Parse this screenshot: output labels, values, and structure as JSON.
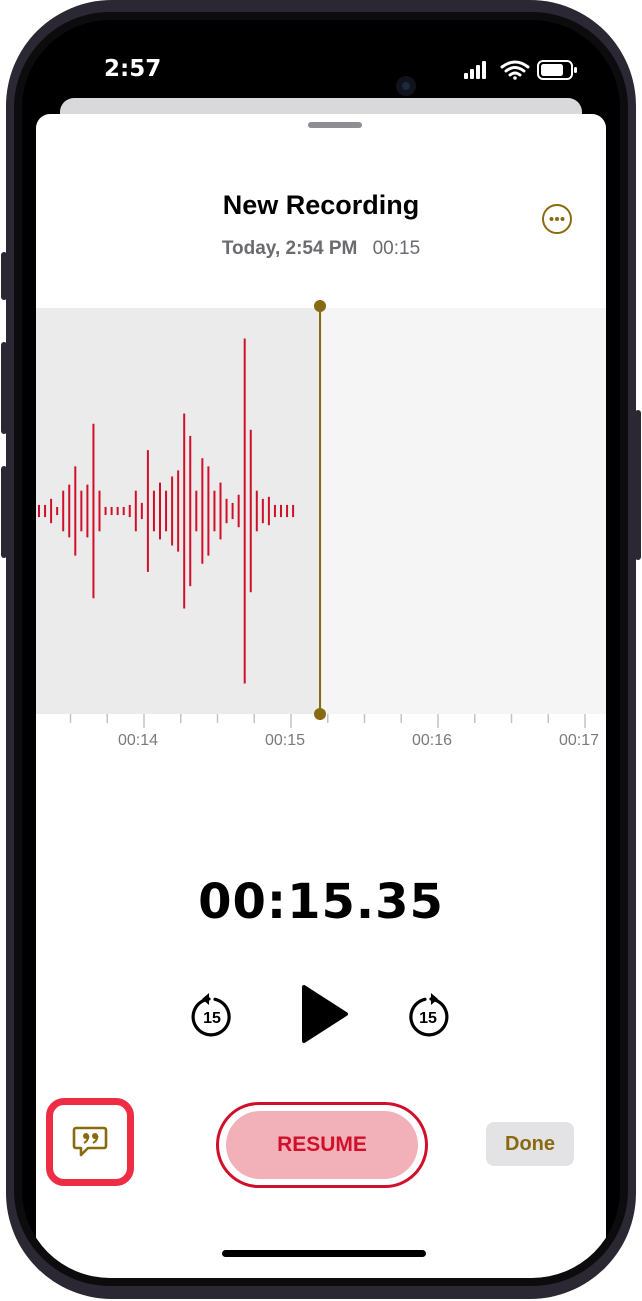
{
  "status_bar": {
    "time": "2:57"
  },
  "recording": {
    "title": "New Recording",
    "date": "Today, 2:54 PM",
    "duration": "00:15"
  },
  "timeline": {
    "ticks": [
      "00:14",
      "00:15",
      "00:16",
      "00:17"
    ]
  },
  "waveform": {
    "amplitudes": [
      0.03,
      0.03,
      0.06,
      0.02,
      0.1,
      0.13,
      0.22,
      0.1,
      0.13,
      0.43,
      0.1,
      0.02,
      0.02,
      0.02,
      0.02,
      0.03,
      0.1,
      0.04,
      0.3,
      0.1,
      0.14,
      0.1,
      0.17,
      0.2,
      0.48,
      0.37,
      0.1,
      0.26,
      0.22,
      0.1,
      0.14,
      0.06,
      0.04,
      0.08,
      0.85,
      0.4,
      0.1,
      0.06,
      0.07,
      0.03,
      0.03,
      0.03,
      0.03
    ],
    "color": "#d0102a"
  },
  "timer": {
    "elapsed": "00:15.35"
  },
  "controls": {
    "skip_back_label": "15",
    "skip_forward_label": "15",
    "resume_label": "RESUME",
    "done_label": "Done"
  },
  "colors": {
    "accent": "#8a6a10",
    "record_red": "#d0102a",
    "highlight": "#ee2d45"
  },
  "icons": {
    "more": "ellipsis-circle-icon",
    "transcript": "quote-bubble-icon",
    "play": "play-icon",
    "skip_back": "gobackward-15-icon",
    "skip_forward": "goforward-15-icon"
  }
}
